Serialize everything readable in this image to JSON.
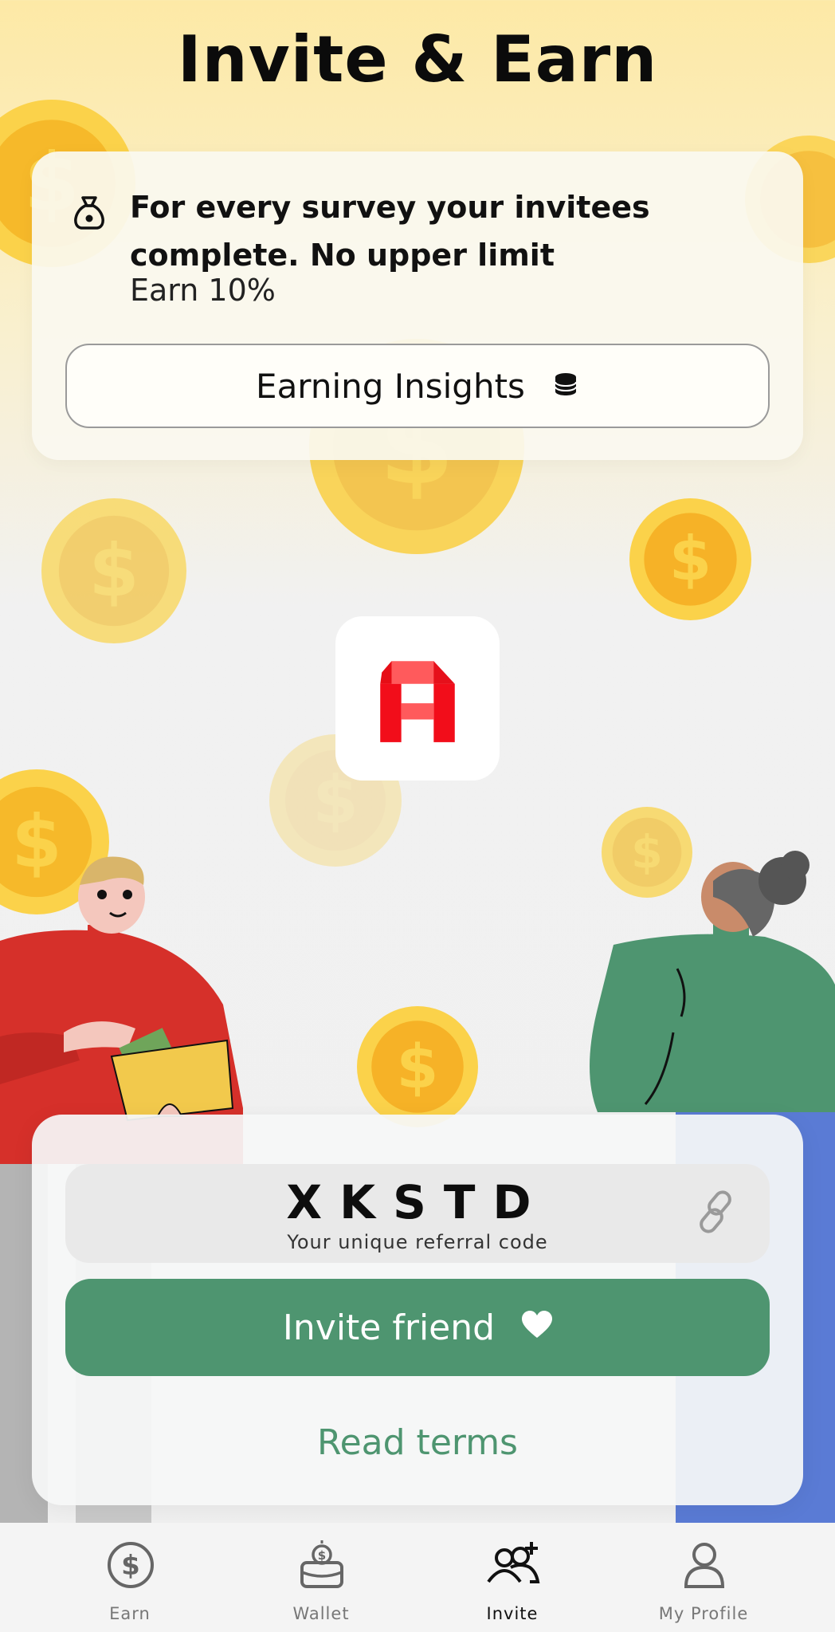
{
  "page": {
    "title": "Invite & Earn"
  },
  "info_card": {
    "headline": "For every survey your invitees complete. No upper limit",
    "subtext": "Earn 10%",
    "insights_button_label": "Earning Insights",
    "icon": "money-bag-icon",
    "button_icon": "coin-stack-icon"
  },
  "app_logo": {
    "icon": "app-logo-a"
  },
  "referral": {
    "code": "XKSTD",
    "caption": "Your unique referral code",
    "copy_icon": "link-icon"
  },
  "invite_button": {
    "label": "Invite friend",
    "icon": "heart-icon"
  },
  "terms": {
    "label": "Read terms"
  },
  "tabbar": {
    "tabs": [
      {
        "label": "Earn",
        "icon": "dollar-coin-icon",
        "active": false
      },
      {
        "label": "Wallet",
        "icon": "wallet-icon",
        "active": false
      },
      {
        "label": "Invite",
        "icon": "add-people-icon",
        "active": true
      },
      {
        "label": "My Profile",
        "icon": "person-icon",
        "active": false
      }
    ]
  },
  "colors": {
    "accent_green": "#4e9570",
    "coin_gold": "#f7c42f",
    "logo_red": "#f20d1a",
    "background_top": "#fde9a6",
    "background_bottom": "#f0f0f0"
  }
}
